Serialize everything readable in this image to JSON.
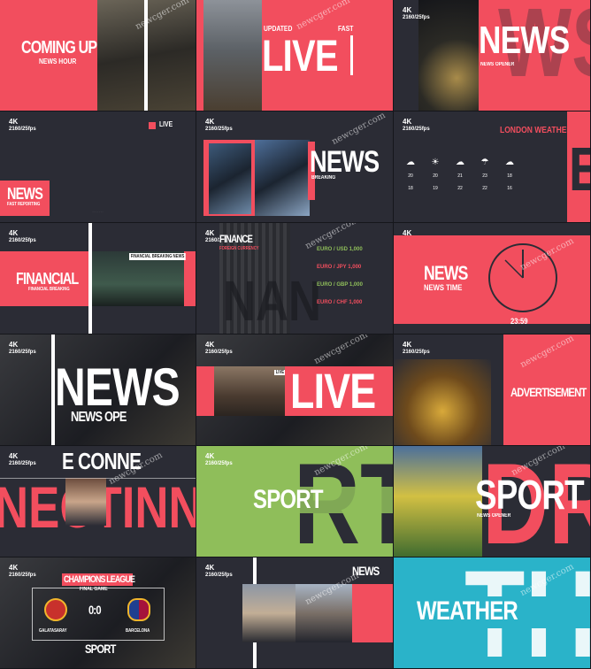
{
  "tiles": {
    "coming_up": {
      "title": "COMING UP",
      "subtitle": "NEWS HOUR"
    },
    "live_1": {
      "title": "LIVE",
      "updated": "UPDATED",
      "fast": "FAST"
    },
    "news_opener": {
      "tag": "4K",
      "title": "NEWS",
      "subtitle": "NEWS OPENER"
    },
    "news_fast": {
      "tag": "4K",
      "live": "LIVE",
      "title": "NEWS",
      "subtitle": "FAST REPORTING"
    },
    "news_breaking": {
      "tag": "4K",
      "title": "NEWS",
      "subtitle": "BREAKING"
    },
    "london_weather": {
      "tag": "4K",
      "title": "LONDON WEATHER",
      "temps_high": [
        "20",
        "20",
        "21",
        "23",
        "18"
      ],
      "temps_low": [
        "18",
        "19",
        "22",
        "22",
        "16"
      ]
    },
    "financial": {
      "tag": "4K",
      "title": "FINANCIAL",
      "subtitle": "FINANCIAL BREAKING",
      "header": "FINANCIAL BREAKING NEWS"
    },
    "finance_currency": {
      "tag": "4K",
      "title": "FINANCE",
      "subtitle": "FOREIGN CURRENCY",
      "rates": [
        "EURO / USD 1,000",
        "EURO / JPY 1,000",
        "EURO / GBP 1,000",
        "EURO / CHF 1,000"
      ]
    },
    "news_time": {
      "tag": "4K",
      "title": "NEWS",
      "subtitle": "NEWS TIME",
      "clock": "23:59"
    },
    "news_ope": {
      "tag": "4K",
      "title": "NEWS",
      "subtitle": "NEWS OPE"
    },
    "live_2": {
      "tag": "4K",
      "title": "LIVE",
      "live": "LIVE"
    },
    "advertisement": {
      "tag": "4K",
      "title": "ADVERTISEMENT"
    },
    "connect": {
      "tag": "4K",
      "title": "E CONNE",
      "ghost": "NECTINNEC"
    },
    "sport_1": {
      "tag": "4K",
      "title": "SPORT"
    },
    "sport_2": {
      "title": "SPORT",
      "subtitle": "NEWS OPENER"
    },
    "champions": {
      "tag": "4K",
      "title": "CHAMPIONS LEAGUE",
      "subtitle": "FINAL GAME",
      "score": "0:0",
      "team_a": "GALATASARAY",
      "team_b": "BARCELONA",
      "footer": "SPORT"
    },
    "interview": {
      "tag": "4K",
      "title": "NEWS"
    },
    "weather": {
      "title": "WEATHER"
    }
  },
  "watermark": "newcger.com",
  "colors": {
    "accent": "#f24e5e",
    "dark": "#2b2c35",
    "green": "#8fbe5a",
    "cyan": "#2ab3c9"
  }
}
